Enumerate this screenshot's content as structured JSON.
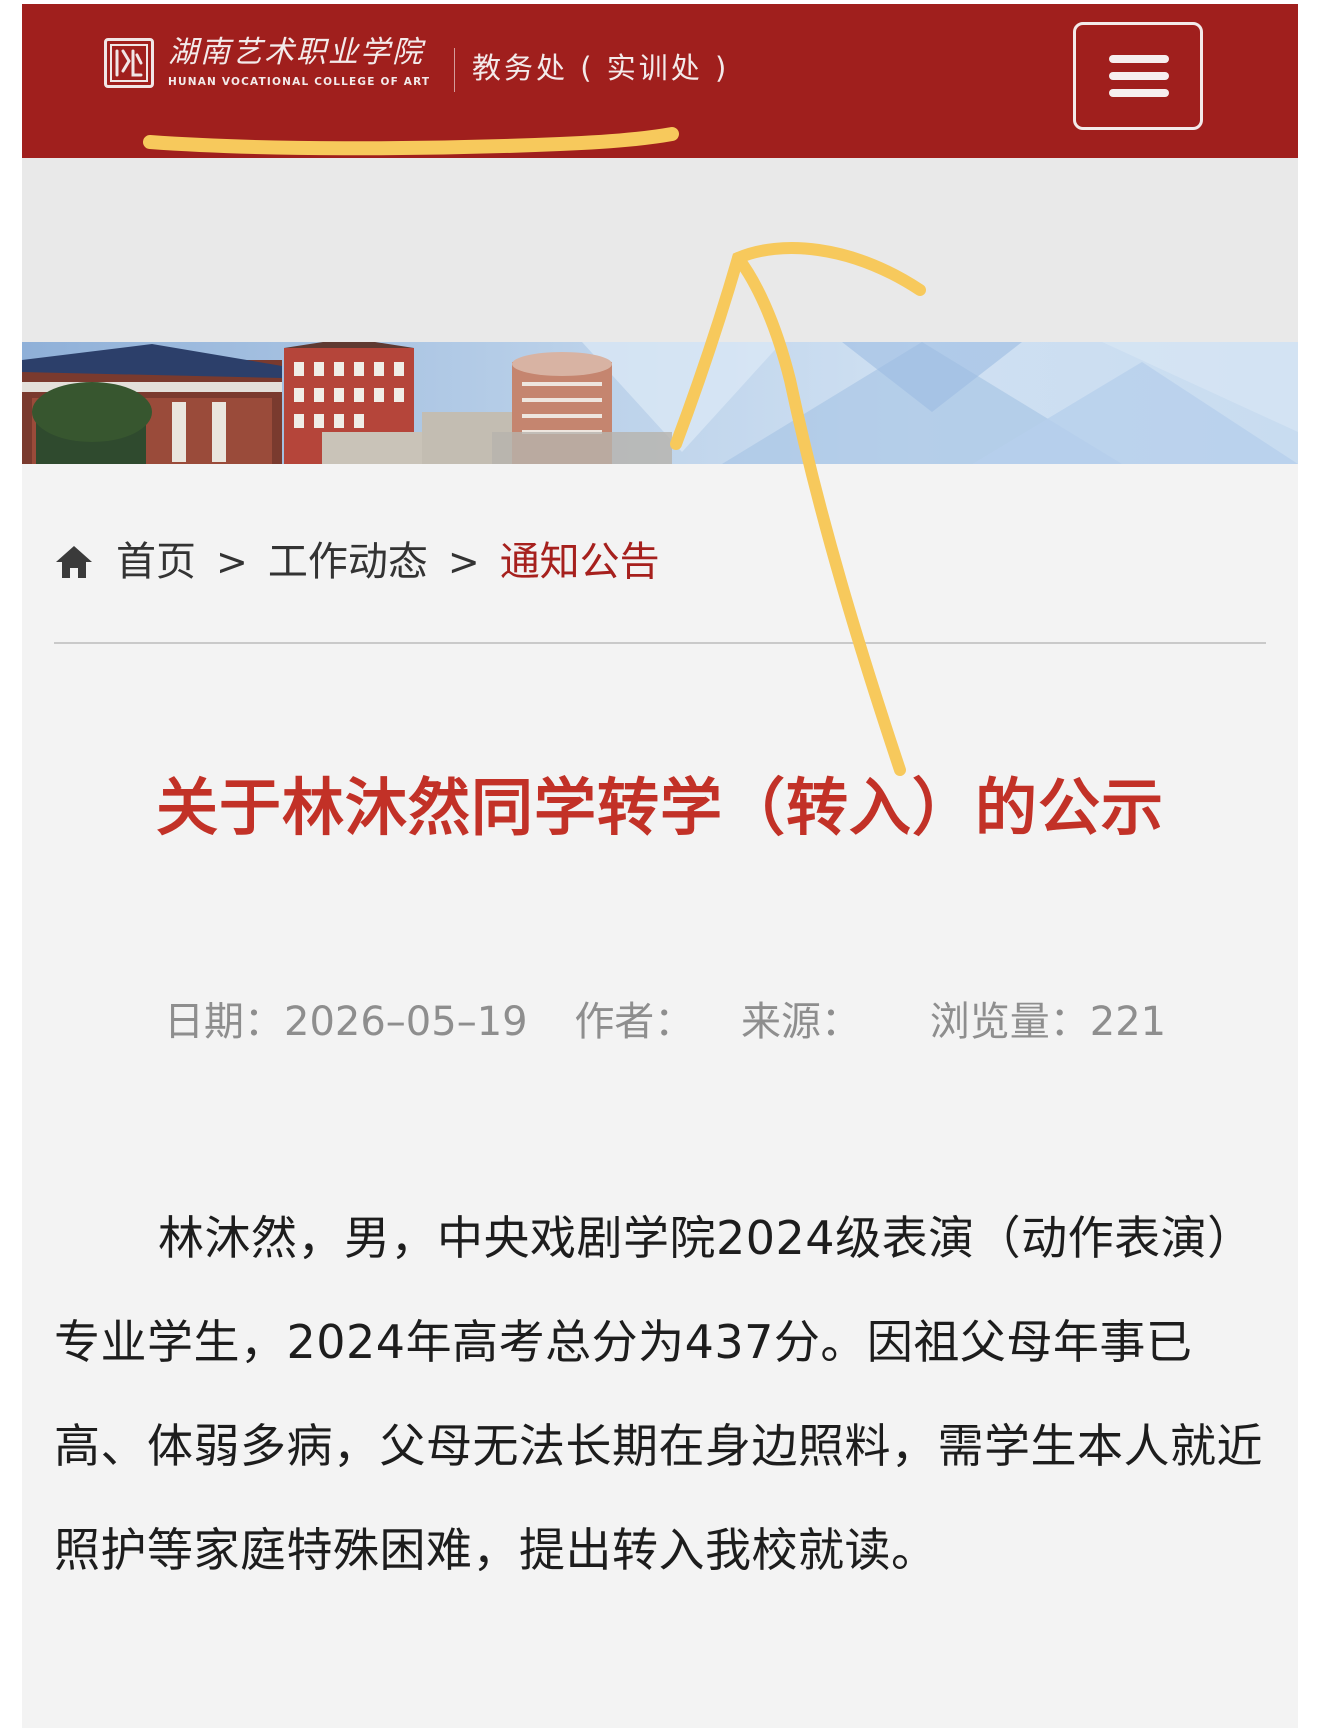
{
  "header": {
    "logo_cn": "湖南艺术职业学院",
    "logo_en": "HUNAN VOCATIONAL COLLEGE OF ART",
    "dept_title": "教务处 ( 实训处 )"
  },
  "breadcrumb": {
    "home": "首页",
    "sep": ">",
    "section": "工作动态",
    "current": "通知公告"
  },
  "article": {
    "title": "关于林沐然同学转学（转入）的公示",
    "meta": {
      "date": "日期：2026–05–19",
      "author": "作者：",
      "source": "来源：",
      "views": "浏览量：221"
    },
    "body": "林沐然，男，中央戏剧学院2024级表演（动作表演）专业学生，2024年高考总分为437分。因祖父母年事已高、体弱多病，父母无法长期在身边照料，需学生本人就近照护等家庭特殊困难，提出转入我校就读。"
  },
  "colors": {
    "header_bg": "#a01f1d",
    "title_red": "#c23127",
    "crumb_active": "#a6201d",
    "annotation_yellow": "#f7c95c"
  },
  "icons": [
    "logo-mark-icon",
    "menu-icon",
    "home-icon"
  ]
}
